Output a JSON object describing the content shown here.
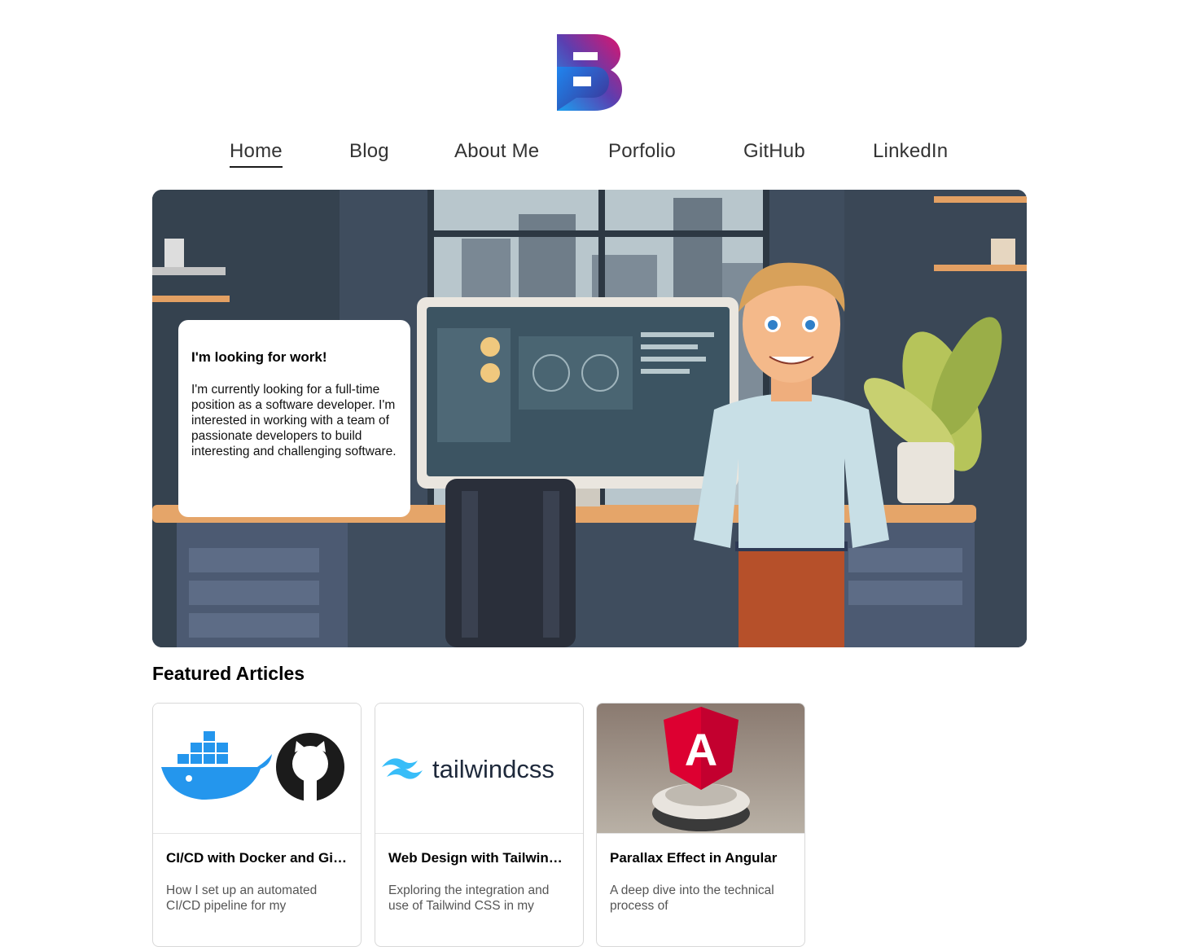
{
  "brand": {
    "logo_letter": "B",
    "gradient_start": "#1e90ff",
    "gradient_end": "#e0136b"
  },
  "nav": {
    "items": [
      {
        "label": "Home",
        "active": true
      },
      {
        "label": "Blog",
        "active": false
      },
      {
        "label": "About Me",
        "active": false
      },
      {
        "label": "Porfolio",
        "active": false
      },
      {
        "label": "GitHub",
        "active": false
      },
      {
        "label": "LinkedIn",
        "active": false
      }
    ]
  },
  "hero": {
    "card_title": "I'm looking for work!",
    "card_text": "I'm currently looking for a full-time position as a software developer. I'm interested in working with a team of passionate developers to build interesting and challenging software."
  },
  "featured": {
    "title": "Featured Articles",
    "articles": [
      {
        "title": "CI/CD with Docker and GitHub Actions",
        "description": "How I set up an automated CI/CD pipeline for my"
      },
      {
        "title": "Web Design with Tailwind CSS",
        "description": "Exploring the integration and use of Tailwind CSS in my",
        "image_text": "tailwindcss"
      },
      {
        "title": "Parallax Effect in Angular",
        "description": "A deep dive into the technical process of",
        "image_text": "A"
      }
    ]
  }
}
